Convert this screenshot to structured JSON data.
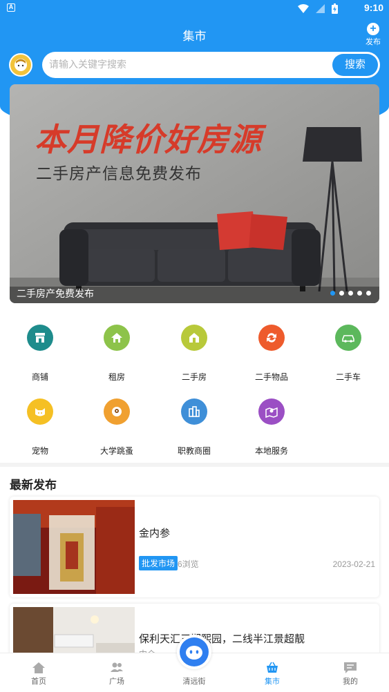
{
  "status_bar": {
    "time": "9:10",
    "left_icon": "A"
  },
  "header": {
    "title": "集市",
    "publish_label": "发布",
    "publish_icon": "plus-circle-icon"
  },
  "search": {
    "placeholder": "请输入关键字搜索",
    "button_label": "搜索"
  },
  "banner": {
    "headline": "本月降价好房源",
    "subline": "二手房产信息免费发布",
    "caption": "二手房产免费发布",
    "slide_count": 5,
    "active_slide": 1
  },
  "categories": [
    {
      "label": "商铺",
      "icon": "shop-icon",
      "color": "#1e8c8c"
    },
    {
      "label": "租房",
      "icon": "rent-house-icon",
      "color": "#8dc34a"
    },
    {
      "label": "二手房",
      "icon": "second-hand-house-icon",
      "color": "#b8c93a"
    },
    {
      "label": "二手物品",
      "icon": "second-hand-goods-icon",
      "color": "#ee5b2c"
    },
    {
      "label": "二手车",
      "icon": "second-hand-car-icon",
      "color": "#5cb85c"
    },
    {
      "label": "宠物",
      "icon": "pet-icon",
      "color": "#f5c024"
    },
    {
      "label": "大学跳蚤",
      "icon": "flea-market-icon",
      "color": "#f0a030"
    },
    {
      "label": "职教商圈",
      "icon": "business-district-icon",
      "color": "#3f8fd8"
    },
    {
      "label": "本地服务",
      "icon": "local-service-icon",
      "color": "#9b4fc4"
    }
  ],
  "latest": {
    "title": "最新发布",
    "items": [
      {
        "title": "金内参",
        "tag": "批发市场",
        "views": "6浏览",
        "date": "2023-02-21"
      },
      {
        "title": "保利天汇三期熙园，二线半江景超靓",
        "subtitle": "中介"
      }
    ]
  },
  "bottom_nav": [
    {
      "label": "首页",
      "icon": "home-icon"
    },
    {
      "label": "广场",
      "icon": "people-icon"
    },
    {
      "label": "清远街",
      "icon": "mascot-icon"
    },
    {
      "label": "集市",
      "icon": "basket-icon",
      "active": true
    },
    {
      "label": "我的",
      "icon": "message-icon"
    }
  ],
  "colors": {
    "accent": "#2196f3",
    "banner_headline": "#d63b2a"
  }
}
